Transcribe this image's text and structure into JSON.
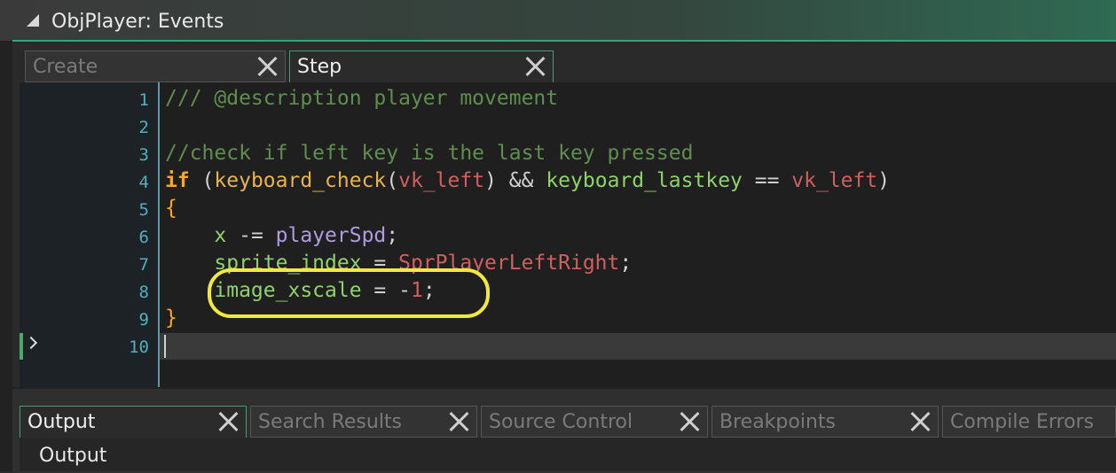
{
  "window": {
    "title": "ObjPlayer: Events"
  },
  "editor_tabs": [
    {
      "label": "Create",
      "active": false
    },
    {
      "label": "Step",
      "active": true
    }
  ],
  "line_numbers": [
    "1",
    "2",
    "3",
    "4",
    "5",
    "6",
    "7",
    "8",
    "9",
    "10"
  ],
  "code": {
    "l1": "/// @description player movement",
    "l3": "//check if left key is the last key pressed",
    "l4": {
      "kw": "if",
      "p1": " (",
      "f1": "keyboard_check",
      "p2": "(",
      "c1": "vk_left",
      "p3": ") && ",
      "f2": "keyboard_lastkey",
      "op": " == ",
      "c2": "vk_left",
      "p4": ")"
    },
    "l5": "{",
    "l6": {
      "indent": "    ",
      "b": "x",
      "op": " -= ",
      "v": "playerSpd",
      "end": ";"
    },
    "l7": {
      "indent": "    ",
      "b": "sprite_index",
      "op": " = ",
      "c": "SprPlayerLeftRight",
      "end": ";"
    },
    "l8": {
      "indent": "    ",
      "b": "image_xscale",
      "op": " = -",
      "n": "1",
      "end": ";"
    },
    "l9": "}"
  },
  "bottom_tabs": [
    {
      "label": "Output",
      "active": true
    },
    {
      "label": "Search Results",
      "active": false
    },
    {
      "label": "Source Control",
      "active": false
    },
    {
      "label": "Breakpoints",
      "active": false
    },
    {
      "label": "Compile Errors",
      "active": false
    }
  ],
  "output_panel": {
    "label": "Output"
  },
  "colors": {
    "accent": "#3aa078",
    "highlight": "#f2ea3a",
    "keyword": "#f5a623",
    "comment": "#5f8f4e",
    "constant": "#d25f5f",
    "builtin": "#8ed36a",
    "variable": "#b09ae0",
    "line_number": "#4fb0c0"
  }
}
